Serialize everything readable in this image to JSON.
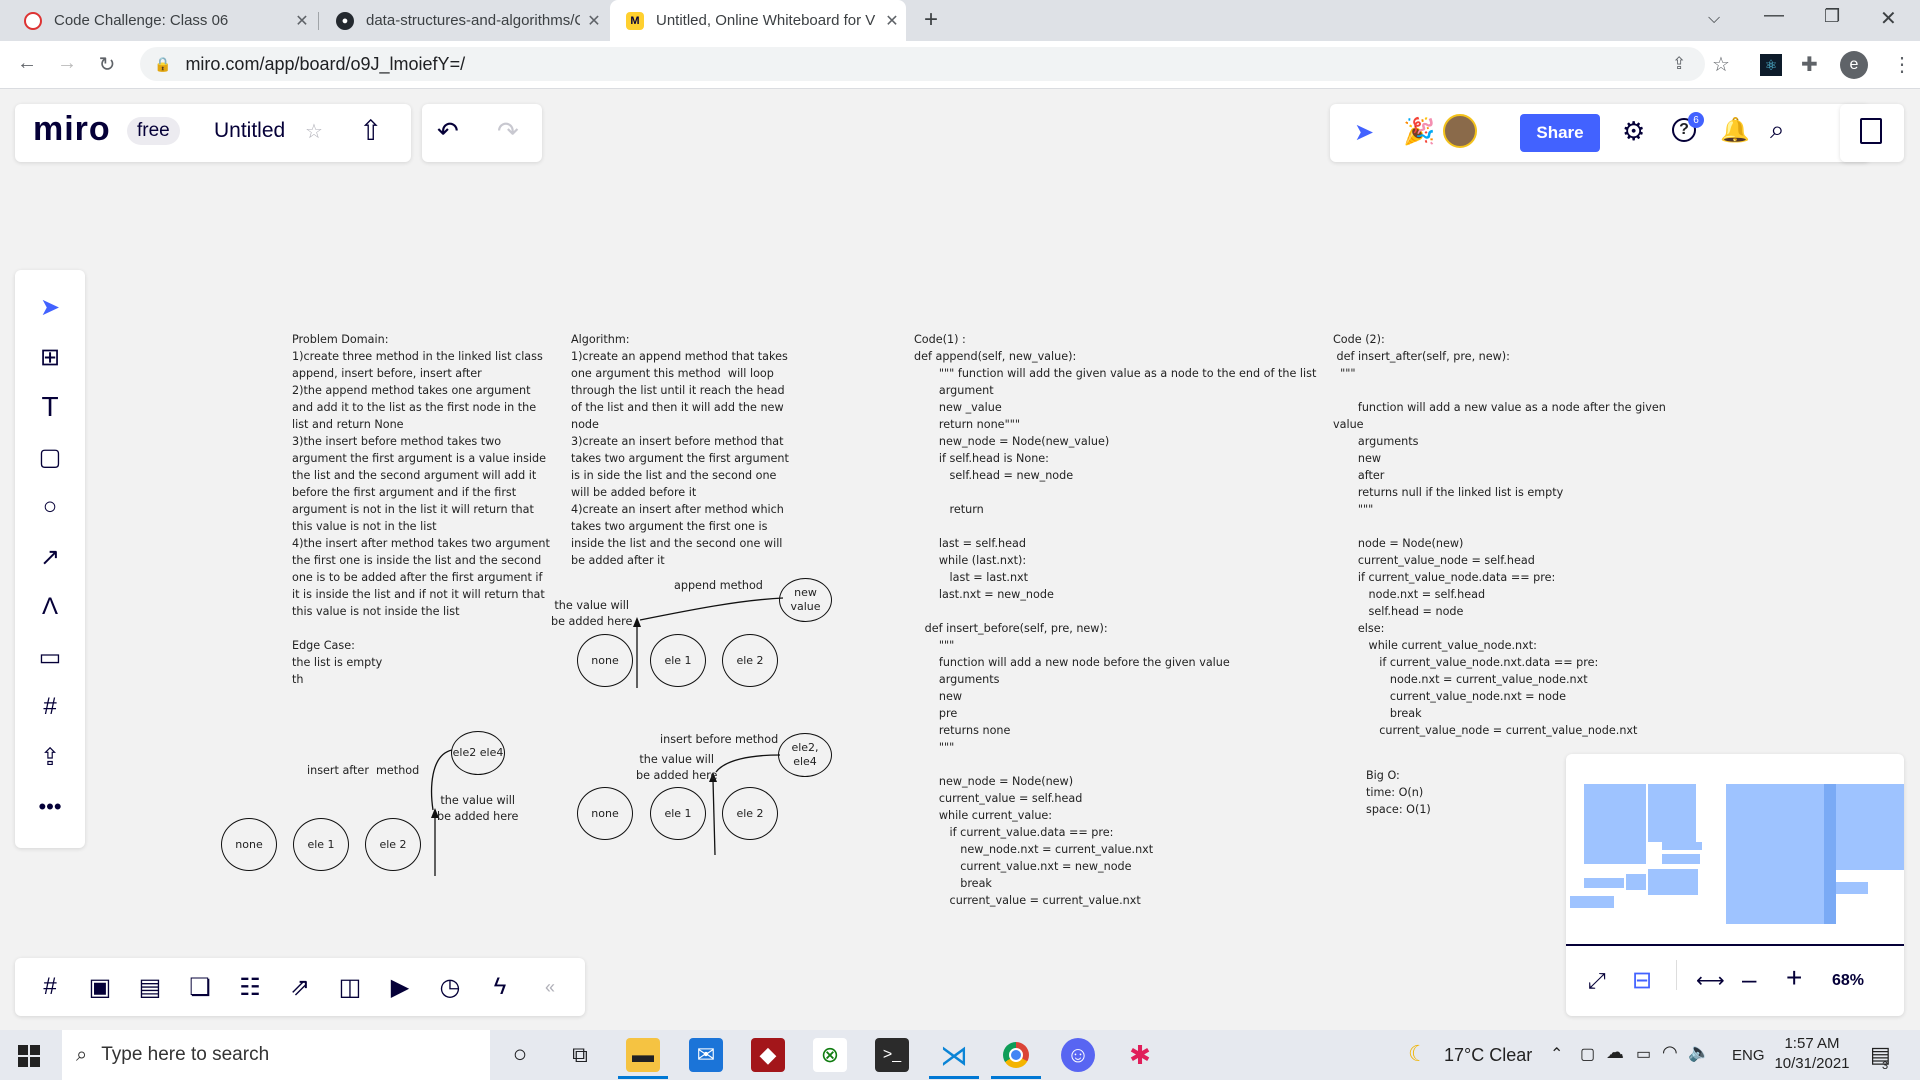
{
  "browser": {
    "tabs": [
      {
        "title": "Code Challenge: Class 06",
        "active": false
      },
      {
        "title": "data-structures-and-algorithms/C",
        "active": false
      },
      {
        "title": "Untitled, Online Whiteboard for V",
        "active": true
      }
    ],
    "new_tab": "+",
    "url": "miro.com/app/board/o9J_lmoiefY=/",
    "profile_initial": "e"
  },
  "miro": {
    "logo": "miro",
    "plan": "free",
    "board_title": "Untitled",
    "share_label": "Share",
    "help_badge": "6",
    "zoom": "68%",
    "collapse_glyph": "«"
  },
  "board": {
    "problem_domain": "Problem Domain:\n1)create three method in the linked list class\nappend, insert before, insert after\n2)the append method takes one argument\nand add it to the list as the first node in the\nlist and return None\n3)the insert before method takes two\nargument the first argument is a value inside\nthe list and the second argument will add it\nbefore the first argument and if the first\nargument is not in the list it will return that\nthis value is not in the list\n4)the insert after method takes two argument\nthe first one is inside the list and the second\none is to be added after the first argument if\nit is inside the list and if not it will return that\nthis value is not inside the list\n\nEdge Case:\nthe list is empty\nth",
    "algorithm": "Algorithm:\n1)create an append method that takes\none argument this method  will loop\nthrough the list until it reach the head\nof the list and then it will add the new\nnode\n3)create an insert before method that\ntakes two argument the first argument\nis in side the list and the second one\nwill be added before it\n4)create an insert after method which\ntakes two argument the first one is\ninside the list and the second one will\nbe added after it",
    "code1": "Code(1) :\ndef append(self, new_value):\n       \"\"\" function will add the given value as a node to the end of the list\n       argument\n       new _value\n       return none\"\"\"\n       new_node = Node(new_value)\n       if self.head is None:\n          self.head = new_node\n\n          return\n\n       last = self.head\n       while (last.nxt):\n          last = last.nxt\n       last.nxt = new_node\n\n   def insert_before(self, pre, new):\n       \"\"\"\n       function will add a new node before the given value\n       arguments\n       new\n       pre\n       returns none\n       \"\"\"\n\n       new_node = Node(new)\n       current_value = self.head\n       while current_value:\n          if current_value.data == pre:\n             new_node.nxt = current_value.nxt\n             current_value.nxt = new_node\n             break\n          current_value = current_value.nxt",
    "code2": "Code (2):\n def insert_after(self, pre, new):\n  \"\"\"\n\n       function will add a new value as a node after the given\nvalue\n       arguments\n       new\n       after\n       returns null if the linked list is empty\n       \"\"\"\n\n       node = Node(new)\n       current_value_node = self.head\n       if current_value_node.data == pre:\n          node.nxt = self.head\n          self.head = node\n       else:\n          while current_value_node.nxt:\n             if current_value_node.nxt.data == pre:\n                node.nxt = current_value_node.nxt\n                current_value_node.nxt = node\n                break\n             current_value_node = current_value_node.nxt",
    "bigo": "Big O:\ntime: O(n)\nspace: O(1)",
    "append_diagram": {
      "title": "append method",
      "new_node": "new\nvalue",
      "note": "the value will\nbe added here",
      "nodes": [
        "none",
        "ele 1",
        "ele 2"
      ]
    },
    "insert_before_diagram": {
      "title": "insert before method",
      "new_node": "ele2,\nele4",
      "note": "the value will\nbe added here",
      "nodes": [
        "none",
        "ele 1",
        "ele 2"
      ]
    },
    "insert_after_diagram": {
      "title": "insert after  method",
      "new_node": "ele2\nele4",
      "note": "the value will\nbe added here",
      "nodes": [
        "none",
        "ele 1",
        "ele 2"
      ]
    }
  },
  "taskbar": {
    "search_placeholder": "Type here to search",
    "weather": "17°C  Clear",
    "language": "ENG",
    "time": "1:57 AM",
    "date": "10/31/2021",
    "notifications": "3"
  }
}
